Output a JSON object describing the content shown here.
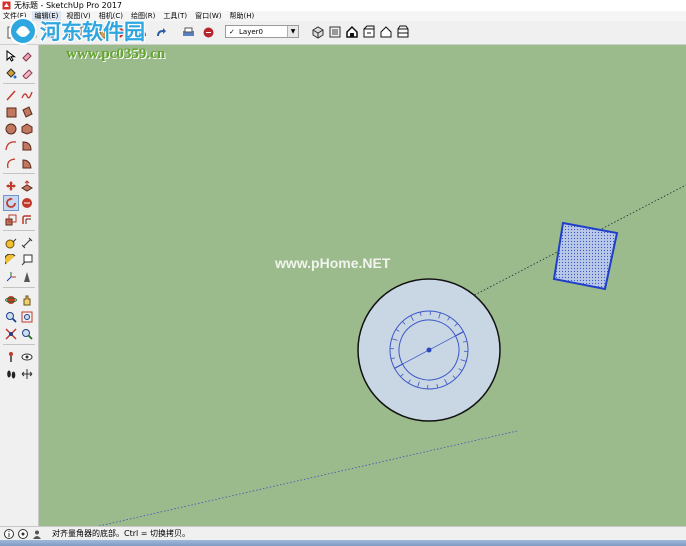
{
  "window": {
    "title": "无标题 - SketchUp Pro 2017",
    "app_icon": "sketchup-logo-icon"
  },
  "menu": [
    {
      "label": "文件(F)"
    },
    {
      "label": "编辑(E)"
    },
    {
      "label": "视图(V)"
    },
    {
      "label": "相机(C)"
    },
    {
      "label": "绘图(R)"
    },
    {
      "label": "工具(T)"
    },
    {
      "label": "窗口(W)"
    },
    {
      "label": "帮助(H)"
    }
  ],
  "toolbar": {
    "layer": {
      "check": "✓",
      "value": "Layer0"
    },
    "view_icons": [
      "iso-view-icon",
      "top-view-icon",
      "front-view-icon",
      "right-view-icon",
      "back-view-icon",
      "left-view-icon"
    ]
  },
  "sidebar": {
    "tools": [
      "select-icon",
      "eraser-icon",
      "paint-bucket-icon",
      "eraser-alt-icon",
      "line-icon",
      "freehand-icon",
      "rectangle-icon",
      "rotated-rectangle-icon",
      "circle-icon",
      "polygon-icon",
      "arc-icon",
      "pie-icon",
      "three-point-arc-icon",
      "two-point-arc-icon",
      "move-icon",
      "push-pull-icon",
      "rotate-icon",
      "follow-me-icon",
      "scale-icon",
      "offset-icon",
      "tape-measure-icon",
      "dimension-icon",
      "protractor-icon",
      "text-icon",
      "axes-icon",
      "3d-text-icon",
      "orbit-icon",
      "pan-icon",
      "zoom-icon",
      "zoom-window-icon",
      "zoom-extents-icon",
      "position-camera-icon",
      "walk-icon",
      "look-around-icon",
      "footprints-icon",
      "section-plane-icon"
    ]
  },
  "status": {
    "message": "对齐量角器的底部。Ctrl = 切换拷贝。",
    "icons": [
      "info-icon",
      "credit-icon",
      "user-icon"
    ]
  },
  "watermarks": {
    "brand": "河东软件园",
    "url": "www.pc0359.cn",
    "center": "www.pHome.NET"
  },
  "colors": {
    "viewport_bg": "#9bbb8c",
    "selection_blue": "#1f3fc8",
    "protractor_fill": "#c9d6e4"
  }
}
